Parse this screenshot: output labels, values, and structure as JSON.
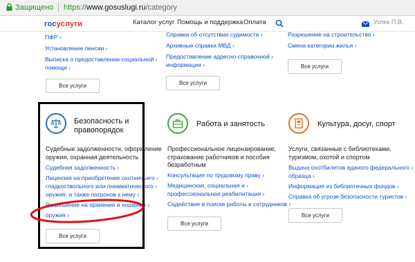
{
  "browser": {
    "secure_label": "Защищено",
    "url_protocol": "https://",
    "url_host": "www.gosuslugi.ru",
    "url_path": "/category"
  },
  "header": {
    "logo_blue": "гос",
    "logo_red": "услуги",
    "nav": [
      "Каталог услуг",
      "Помощь и поддержка",
      "Оплата"
    ],
    "user_name": "Успек П.В."
  },
  "top_columns": [
    {
      "links": [
        "ПФР",
        "Установление пенсии",
        "Выписка о предоставлении социальной",
        "помощи"
      ],
      "button": "Все услуги"
    },
    {
      "links": [
        "Справка об отсутствии судимости",
        "Архивные справки МВД",
        "Предоставление адресно-справочной",
        "информации"
      ],
      "button": "Все услуги"
    },
    {
      "links": [
        "Разрешение на строительство",
        "Смена категории жилья"
      ],
      "button": "Все услуги"
    }
  ],
  "categories": [
    {
      "title_lines": [
        "Безопасность и",
        "правопорядок"
      ],
      "desc_lines": [
        "Судебные задолженности, оформление",
        "оружия, охранная деятельность"
      ],
      "links": [
        "Судебная задолженность",
        "Лицензия на приобретение охотничьего",
        "гладкоствольного или пневматического",
        "оружия, а также патронов к нему",
        "Разрешение на хранение и ношение",
        "оружия"
      ],
      "button": "Все услуги",
      "icon_name": "scales-icon",
      "color": "#2a6fa8"
    },
    {
      "title_lines": [
        "Работа и занятость"
      ],
      "desc_lines": [
        "Профессиональное лицензирование,",
        "страхование работников и пособия",
        "безработным"
      ],
      "links": [
        "Консультация по трудовому праву",
        "Медицинская, социальная и",
        "профессиональная реабилитация",
        "Содействие в поиске работы и сотрудников"
      ],
      "button": "Все услуги",
      "icon_name": "briefcase-icon",
      "color": "#3aa63a"
    },
    {
      "title_lines": [
        "Культура, досуг, спорт"
      ],
      "desc_lines": [
        "Услуги, связанные с библиотеками,",
        "туризмом, охотой и спортом"
      ],
      "links": [
        "Выдача охотбилетов единого федерального",
        "образца",
        "Информация из библиотечных фондов",
        "Справка об угрозе безопасности туристов"
      ],
      "button": "Все услуги",
      "icon_name": "book-icon",
      "color": "#e07020"
    }
  ],
  "colors": {
    "link": "#0d4cd3",
    "secure_green": "#2c8a2c",
    "highlight_red": "#e01010",
    "frame_black": "#000000"
  }
}
